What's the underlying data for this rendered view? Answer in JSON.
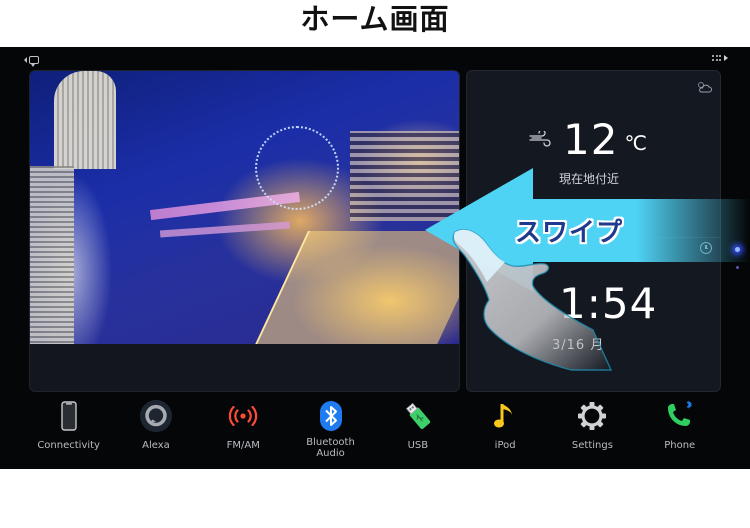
{
  "page": {
    "title": "ホーム画面"
  },
  "status_bar": {
    "left_icons": [
      "back-arrow-icon",
      "chat-bubble-icon"
    ],
    "right_icons": [
      "app-grid-icon",
      "forward-arrow-icon"
    ]
  },
  "weather_widget": {
    "corner_icon": "partly-cloudy-icon",
    "condition_icon": "wind-icon",
    "temperature": "12",
    "unit": "℃",
    "location": "現在地付近"
  },
  "clock_widget": {
    "corner_icon": "clock-icon",
    "time": "1:54",
    "date": "3/16 月"
  },
  "overlay": {
    "label": "スワイプ",
    "arrow_color": "#4fd3f5",
    "text_color": "#1f3a8c"
  },
  "page_indicator": {
    "pages": 2,
    "active": 1
  },
  "dock": {
    "items": [
      {
        "label": "Connectivity",
        "icon": "smartphone-icon"
      },
      {
        "label": "Alexa",
        "icon": "alexa-ring-icon"
      },
      {
        "label": "FM/AM",
        "icon": "radio-broadcast-icon",
        "color": "#ff4a3a"
      },
      {
        "label": "Bluetooth\nAudio",
        "label_line1": "Bluetooth",
        "label_line2": "Audio",
        "icon": "bluetooth-icon",
        "color": "#1f7cf0"
      },
      {
        "label": "USB",
        "icon": "usb-stick-icon",
        "color": "#3ecf6a"
      },
      {
        "label": "iPod",
        "icon": "music-note-icon",
        "color": "#f6c81e"
      },
      {
        "label": "Settings",
        "icon": "gear-icon"
      },
      {
        "label": "Phone",
        "icon": "phone-icon",
        "color": "#2fcf5f"
      }
    ]
  }
}
